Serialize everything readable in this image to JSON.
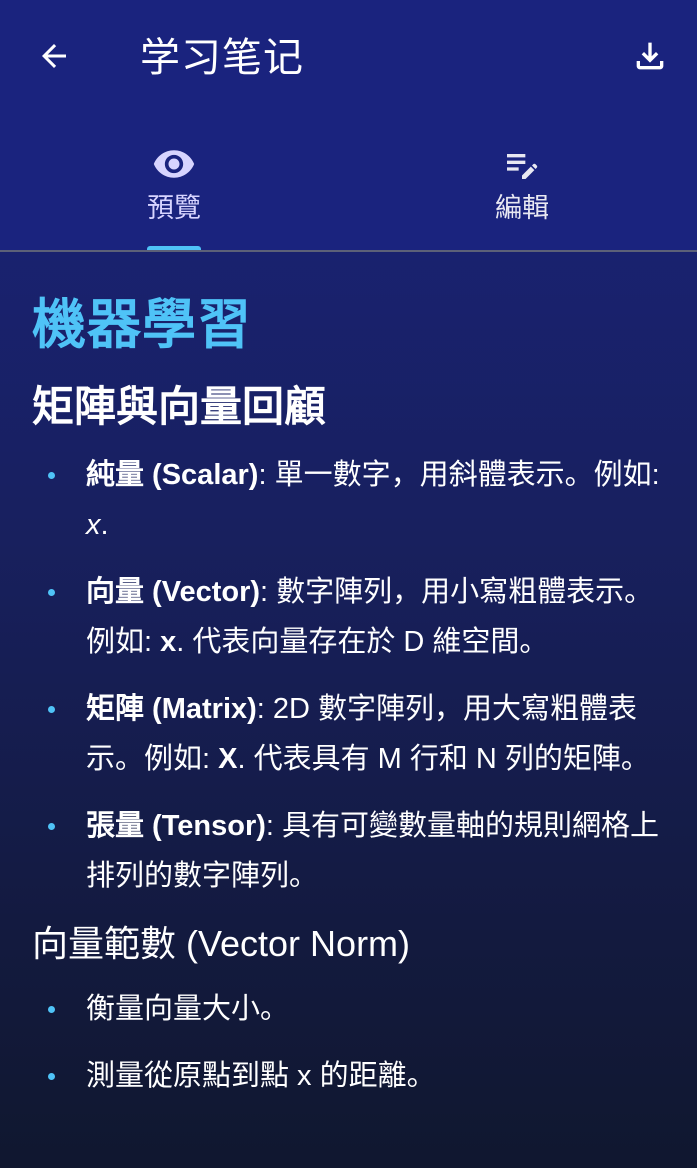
{
  "app_bar": {
    "title": "学习笔记",
    "back_icon": "arrow-back-icon",
    "download_icon": "download-icon"
  },
  "tabs": [
    {
      "label": "預覽",
      "icon": "eye-icon",
      "selected": true
    },
    {
      "label": "編輯",
      "icon": "edit-note-icon",
      "selected": false
    }
  ],
  "colors": {
    "appbar": "#1a237e",
    "accent": "#4fc3f7",
    "background_end": "#10172f"
  },
  "content": {
    "h1": "機器學習",
    "h2": "矩陣與向量回顧",
    "items": [
      {
        "term": "純量 (Scalar)",
        "colon": ": ",
        "desc": "單一數字，用斜體表示。例如: ",
        "example": "x",
        "rest": "."
      },
      {
        "term": "向量 (Vector)",
        "colon": ": ",
        "desc": "數字陣列，用小寫粗體表示。例如: ",
        "example": "x",
        "rest": ". 代表向量存在於 D 維空間。"
      },
      {
        "term": "矩陣 (Matrix)",
        "colon": ": ",
        "desc": "2D 數字陣列，用大寫粗體表示。例如: ",
        "example": "X",
        "rest": ". 代表具有 M 行和 N 列的矩陣。"
      },
      {
        "term": "張量 (Tensor)",
        "colon": ": ",
        "desc": "具有可變數量軸的規則網格上排列的數字陣列。"
      }
    ],
    "h3": "向量範數 (Vector Norm)",
    "norm_items": [
      "衡量向量大小。",
      "測量從原點到點 x 的距離。"
    ]
  }
}
